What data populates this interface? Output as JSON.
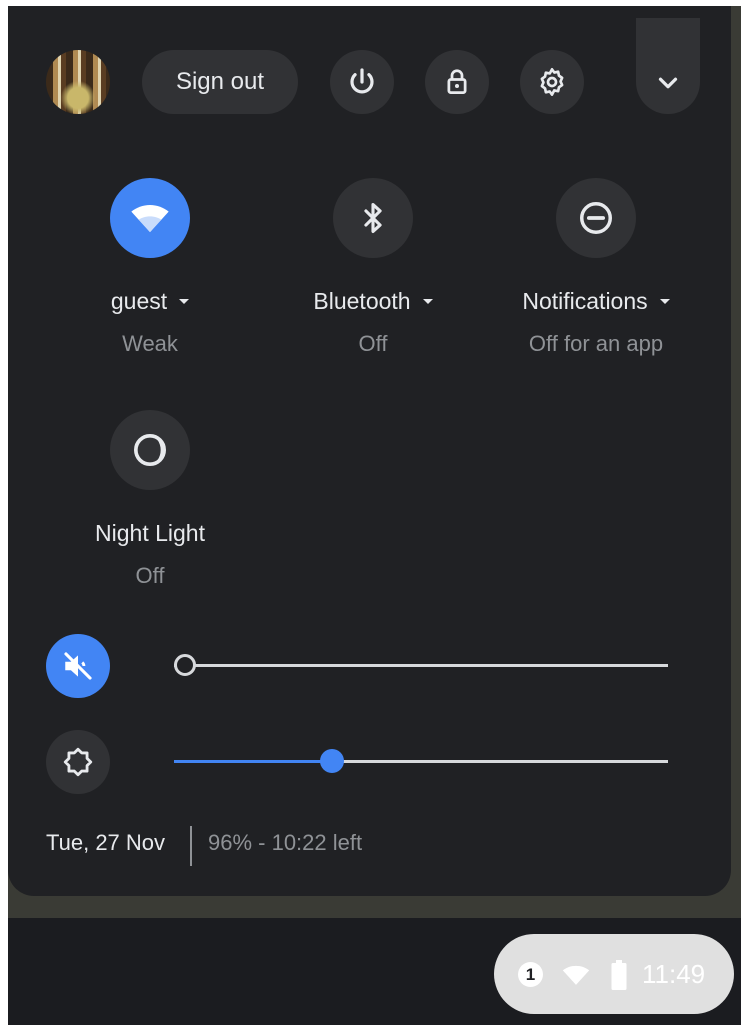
{
  "top_bar": {
    "sign_out_label": "Sign out"
  },
  "pods": [
    {
      "label": "guest",
      "sub": "Weak",
      "icon": "wifi-icon",
      "active": true
    },
    {
      "label": "Bluetooth",
      "sub": "Off",
      "icon": "bluetooth-icon",
      "active": false
    },
    {
      "label": "Notifications",
      "sub": "Off for an app",
      "icon": "do-not-disturb-icon",
      "active": false
    },
    {
      "label": "Night Light",
      "sub": "Off",
      "icon": "night-light-icon",
      "active": false
    }
  ],
  "sliders": {
    "volume": {
      "icon": "volume-muted-icon",
      "level": 0,
      "muted": true
    },
    "brightness": {
      "icon": "brightness-icon",
      "level": 0.32
    }
  },
  "footer": {
    "date": "Tue, 27 Nov",
    "battery": "96% - 10:22 left"
  },
  "shelf": {
    "notification_count": "1",
    "time": "11:49"
  },
  "colors": {
    "panel_bg": "#202124",
    "button_bg": "#313235",
    "accent": "#4285f4",
    "primary_text": "#e8eaed",
    "secondary_text": "#8f9296"
  }
}
